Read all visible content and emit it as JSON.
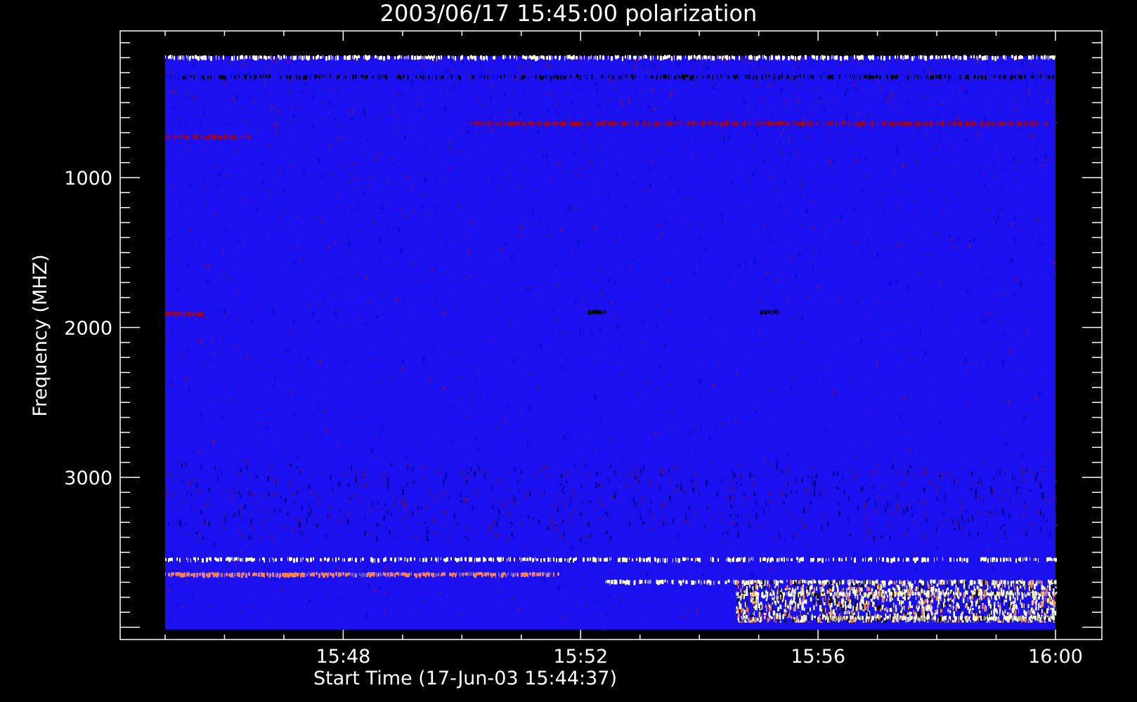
{
  "chart_data": {
    "type": "heatmap",
    "title": "2003/06/17 15:45:00 polarization",
    "xlabel": "Start Time (17-Jun-03 15:44:37)",
    "ylabel": "Frequency (MHZ)",
    "x_ticks": [
      "15:48",
      "15:52",
      "15:56",
      "16:00"
    ],
    "x_tick_minutes": [
      3.383,
      7.383,
      11.383,
      15.383
    ],
    "x_data_range_minutes": [
      0.383,
      15.383
    ],
    "y_ticks": [
      1000,
      2000,
      3000
    ],
    "ylim": [
      3900,
      100
    ],
    "y_data_range": [
      190,
      4000
    ],
    "color_scale": [
      "#000000",
      "#0000ff",
      "#b00000",
      "#ff8040",
      "#ffffd0"
    ],
    "features": [
      {
        "kind": "band",
        "freq": 200,
        "t_start": 0.383,
        "t_end": 15.383,
        "color": "#ffffd0",
        "density": 0.6
      },
      {
        "kind": "band",
        "freq": 330,
        "t_start": 0.383,
        "t_end": 15.383,
        "color": "#000000",
        "density": 0.5
      },
      {
        "kind": "band",
        "freq": 640,
        "t_start": 5.5,
        "t_end": 15.383,
        "color": "#b00000",
        "density": 0.7
      },
      {
        "kind": "band",
        "freq": 730,
        "t_start": 0.383,
        "t_end": 1.8,
        "color": "#b00000",
        "density": 0.8
      },
      {
        "kind": "band",
        "freq": 1910,
        "t_start": 0.383,
        "t_end": 1.0,
        "color": "#b00000",
        "density": 1.0
      },
      {
        "kind": "band",
        "freq": 1900,
        "t_start": 7.5,
        "t_end": 7.8,
        "color": "#000000",
        "density": 1.0
      },
      {
        "kind": "band",
        "freq": 1900,
        "t_start": 10.4,
        "t_end": 10.7,
        "color": "#000000",
        "density": 1.0
      },
      {
        "kind": "band",
        "freq": 3550,
        "t_start": 0.383,
        "t_end": 15.383,
        "color": "#ffffd0",
        "density": 0.55
      },
      {
        "kind": "band",
        "freq": 3650,
        "t_start": 0.383,
        "t_end": 7.0,
        "color": "#ff8040",
        "density": 0.9
      },
      {
        "kind": "band",
        "freq": 3700,
        "t_start": 7.8,
        "t_end": 15.383,
        "color": "#ffffd0",
        "density": 0.5
      },
      {
        "kind": "band",
        "freq": 3780,
        "t_start": 10.0,
        "t_end": 15.383,
        "color": "#ffffd0",
        "density": 0.6
      },
      {
        "kind": "band",
        "freq": 3940,
        "t_start": 11.5,
        "t_end": 15.383,
        "color": "#ffffd0",
        "density": 0.7
      }
    ]
  }
}
